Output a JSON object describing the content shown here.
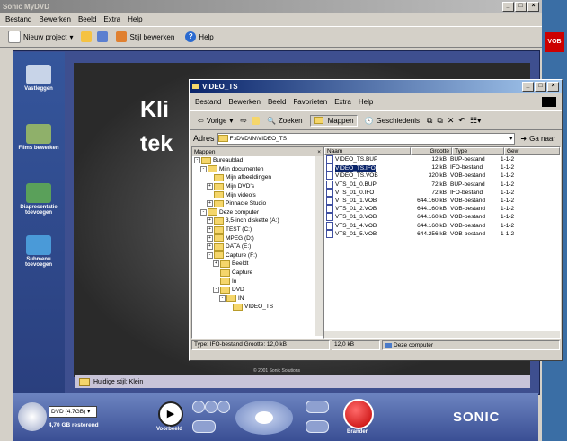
{
  "main_window": {
    "title": "Sonic MyDVD",
    "menu": [
      "Bestand",
      "Bewerken",
      "Beeld",
      "Extra",
      "Help"
    ],
    "toolbar": {
      "new_project": "Nieuw project",
      "edit_style": "Stijl bewerken",
      "help": "Help"
    },
    "sidebar": [
      "Vastleggen",
      "Films bewerken",
      "Diapresentatie toevoegen",
      "Submenu toevoegen"
    ],
    "canvas_text": [
      "Kli",
      "tek"
    ],
    "status_label": "Huidige stijl: Klein",
    "copyright": "© 2001 Sonic Solutions",
    "disc": {
      "type": "DVD (4.7GB)",
      "remaining": "4,70 GB resterend"
    },
    "preview_label": "Voorbeeld",
    "burn_label": "Branden",
    "brand": "SONIC"
  },
  "explorer": {
    "title": "VIDEO_TS",
    "menu": [
      "Bestand",
      "Bewerken",
      "Beeld",
      "Favorieten",
      "Extra",
      "Help"
    ],
    "toolbar": {
      "back": "Vorige",
      "search": "Zoeken",
      "folders": "Mappen",
      "history": "Geschiedenis"
    },
    "address_label": "Adres",
    "address_value": "F:\\DVD\\IN\\VIDEO_TS",
    "go_label": "Ga naar",
    "tree_header": "Mappen",
    "tree": [
      {
        "label": "Bureaublad",
        "indent": 0,
        "expander": "-"
      },
      {
        "label": "Mijn documenten",
        "indent": 1,
        "expander": "-"
      },
      {
        "label": "Mijn afbeeldingen",
        "indent": 2,
        "expander": ""
      },
      {
        "label": "Mijn DVD's",
        "indent": 2,
        "expander": "+"
      },
      {
        "label": "Mijn video's",
        "indent": 2,
        "expander": ""
      },
      {
        "label": "Pinnacle Studio",
        "indent": 2,
        "expander": "+"
      },
      {
        "label": "Deze computer",
        "indent": 1,
        "expander": "-"
      },
      {
        "label": "3,5-inch diskette (A:)",
        "indent": 2,
        "expander": "+"
      },
      {
        "label": "TEST (C:)",
        "indent": 2,
        "expander": "+"
      },
      {
        "label": "MPEG (D:)",
        "indent": 2,
        "expander": "+"
      },
      {
        "label": "DATA (E:)",
        "indent": 2,
        "expander": "+"
      },
      {
        "label": "Capture (F:)",
        "indent": 2,
        "expander": "-"
      },
      {
        "label": "Beeldt",
        "indent": 3,
        "expander": "+"
      },
      {
        "label": "Capture",
        "indent": 3,
        "expander": ""
      },
      {
        "label": "In",
        "indent": 3,
        "expander": ""
      },
      {
        "label": "DVD",
        "indent": 3,
        "expander": "-"
      },
      {
        "label": "IN",
        "indent": 4,
        "expander": "-"
      },
      {
        "label": "VIDEO_TS",
        "indent": 5,
        "expander": ""
      }
    ],
    "columns": [
      "Naam",
      "Grootte",
      "Type",
      "Gew"
    ],
    "files": [
      [
        "VIDEO_TS.BUP",
        "12 kB",
        "BUP-bestand",
        "1-1-2"
      ],
      [
        "VIDEO_TS.IFO",
        "12 kB",
        "IFO-bestand",
        "1-1-2"
      ],
      [
        "VIDEO_TS.VOB",
        "320 kB",
        "VOB-bestand",
        "1-1-2"
      ],
      [
        "VTS_01_0.BUP",
        "72 kB",
        "BUP-bestand",
        "1-1-2"
      ],
      [
        "VTS_01_0.IFO",
        "72 kB",
        "IFO-bestand",
        "1-1-2"
      ],
      [
        "VTS_01_1.VOB",
        "644.160 kB",
        "VOB-bestand",
        "1-1-2"
      ],
      [
        "VTS_01_2.VOB",
        "644.160 kB",
        "VOB-bestand",
        "1-1-2"
      ],
      [
        "VTS_01_3.VOB",
        "644.160 kB",
        "VOB-bestand",
        "1-1-2"
      ],
      [
        "VTS_01_4.VOB",
        "644.160 kB",
        "VOB-bestand",
        "1-1-2"
      ],
      [
        "VTS_01_5.VOB",
        "644.256 kB",
        "VOB-bestand",
        "1-1-2"
      ]
    ],
    "selected_row": 1,
    "status_text": "Type: IFO-bestand Grootte: 12,0 kB",
    "status_size": "12,0 kB",
    "status_zone": "Deze computer"
  },
  "desktop_icon_label": "VOB"
}
